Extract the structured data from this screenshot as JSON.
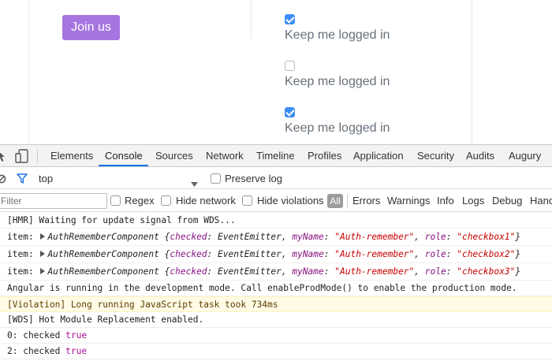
{
  "page": {
    "join_button": "Join us",
    "checkboxes": [
      {
        "label": "Keep me logged in",
        "checked": true
      },
      {
        "label": "Keep me logged in",
        "checked": false
      },
      {
        "label": "Keep me logged in",
        "checked": true
      }
    ]
  },
  "devtools": {
    "tabs": [
      "Elements",
      "Console",
      "Sources",
      "Network",
      "Timeline",
      "Profiles",
      "Application",
      "Security",
      "Audits",
      "Augury"
    ],
    "active_tab": "Console",
    "context": "top",
    "preserve_log": "Preserve log",
    "filter_placeholder": "Filter",
    "filter_options": {
      "regex": "Regex",
      "hide_network": "Hide network",
      "hide_violations": "Hide violations",
      "all": "All",
      "levels": [
        "Errors",
        "Warnings",
        "Info",
        "Logs",
        "Debug",
        "Handled"
      ]
    }
  },
  "console": {
    "hmr": "[HMR] Waiting for update signal from WDS...",
    "items": [
      {
        "prefix": "item:",
        "class": "AuthRememberComponent",
        "checked": "checked",
        "checked_val": "EventEmitter",
        "myName": "myName",
        "myName_val": "\"Auth-remember\"",
        "role": "role",
        "role_val": "\"checkbox1\""
      },
      {
        "prefix": "item:",
        "class": "AuthRememberComponent",
        "checked": "checked",
        "checked_val": "EventEmitter",
        "myName": "myName",
        "myName_val": "\"Auth-remember\"",
        "role": "role",
        "role_val": "\"checkbox2\""
      },
      {
        "prefix": "item:",
        "class": "AuthRememberComponent",
        "checked": "checked",
        "checked_val": "EventEmitter",
        "myName": "myName",
        "myName_val": "\"Auth-remember\"",
        "role": "role",
        "role_val": "\"checkbox3\""
      }
    ],
    "angular": "Angular is running in the development mode. Call enableProdMode() to enable the production mode.",
    "violation": "[Violation] Long running JavaScript task took 734ms",
    "wds": "[WDS] Hot Module Replacement enabled.",
    "checked_lines": [
      {
        "prefix": "0: checked",
        "value": "true"
      },
      {
        "prefix": "2: checked",
        "value": "true"
      }
    ]
  },
  "colors": {
    "accent_button": "#a675e0",
    "checkbox_checked": "#3e8ef7",
    "active_tab_underline": "#1a73e8",
    "warning_bg": "#fffbe5"
  }
}
